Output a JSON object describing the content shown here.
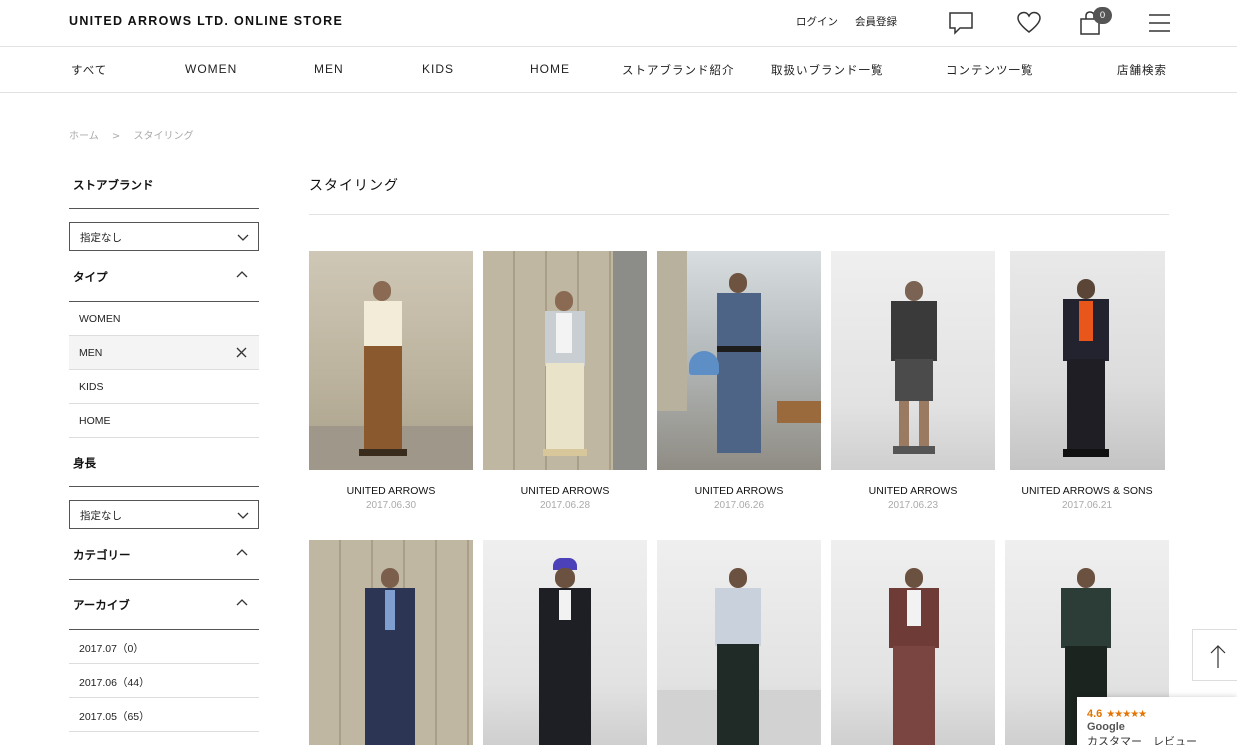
{
  "header": {
    "logo": "UNITED ARROWS LTD. ONLINE STORE",
    "login": "ログイン",
    "register": "会員登録",
    "cart_count": "0",
    "icons": [
      "message-icon",
      "heart-icon",
      "cart-icon",
      "menu-icon"
    ]
  },
  "nav": [
    "すべて",
    "WOMEN",
    "MEN",
    "KIDS",
    "HOME",
    "ストアブランド紹介",
    "取扱いブランド一覧",
    "コンテンツ一覧",
    "店舗検索"
  ],
  "breadcrumb": [
    "ホーム",
    ">",
    "スタイリング"
  ],
  "sidebar": {
    "store_brand": {
      "heading": "ストアブランド",
      "select": "指定なし"
    },
    "type": {
      "heading": "タイプ",
      "items": [
        "WOMEN",
        "MEN",
        "KIDS",
        "HOME"
      ],
      "active": "MEN"
    },
    "height": {
      "heading": "身長",
      "select": "指定なし"
    },
    "category": {
      "heading": "カテゴリー"
    },
    "archive": {
      "heading": "アーカイブ",
      "items": [
        "2017.07（0）",
        "2017.06（44）",
        "2017.05（65）"
      ]
    }
  },
  "main": {
    "title": "スタイリング",
    "cards": [
      {
        "brand": "UNITED ARROWS",
        "date": "2017.06.30"
      },
      {
        "brand": "UNITED ARROWS",
        "date": "2017.06.28"
      },
      {
        "brand": "UNITED ARROWS",
        "date": "2017.06.26"
      },
      {
        "brand": "UNITED ARROWS",
        "date": "2017.06.23"
      },
      {
        "brand": "UNITED ARROWS & SONS",
        "date": "2017.06.21"
      },
      {
        "brand": "",
        "date": ""
      },
      {
        "brand": "",
        "date": ""
      },
      {
        "brand": "",
        "date": ""
      },
      {
        "brand": "",
        "date": ""
      },
      {
        "brand": "",
        "date": ""
      }
    ]
  },
  "review_badge": {
    "score": "4.6",
    "stars": "★★★★★",
    "provider": "Google",
    "label": "カスタマー　レビュー"
  },
  "colors": {
    "text": "#222222",
    "muted": "#aaaaaa",
    "rule": "#e2e2e2",
    "star": "#e37400"
  }
}
